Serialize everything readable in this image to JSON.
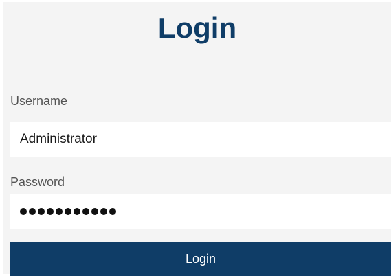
{
  "login_form": {
    "title": "Login",
    "username_label": "Username",
    "username_value": "Administrator",
    "password_label": "Password",
    "password_value": "•••••••••••",
    "submit_label": "Login"
  },
  "colors": {
    "accent": "#0f3d67",
    "panel_background": "#f4f4f4",
    "field_background": "#ffffff",
    "label_text": "#555555"
  }
}
